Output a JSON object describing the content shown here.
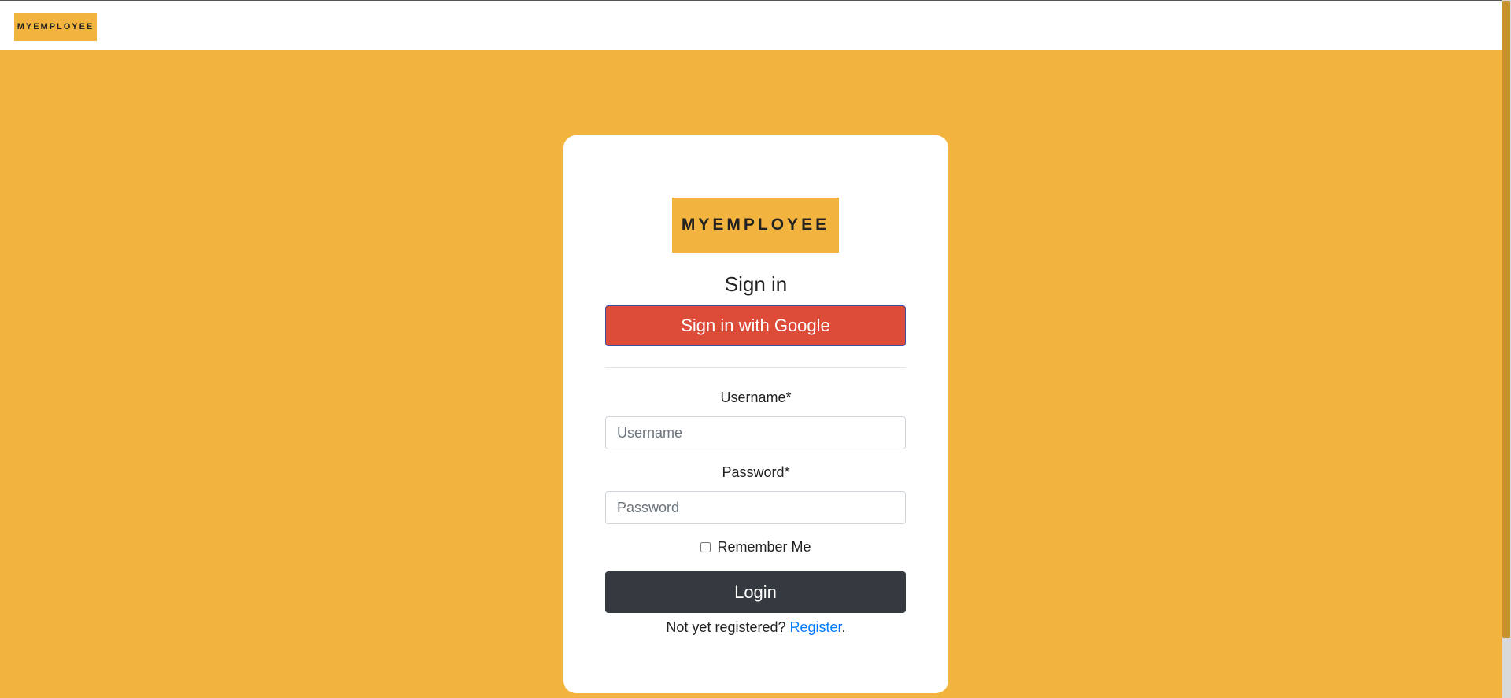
{
  "header": {
    "logo_text": "MYEMPLOYEE"
  },
  "login_card": {
    "logo_text": "MYEMPLOYEE",
    "title": "Sign in",
    "google_button": "Sign in with Google",
    "username": {
      "label": "Username*",
      "placeholder": "Username",
      "value": ""
    },
    "password": {
      "label": "Password*",
      "placeholder": "Password",
      "value": ""
    },
    "remember_me_label": "Remember Me",
    "login_button": "Login",
    "register_prompt": "Not yet registered?",
    "register_link": "Register",
    "register_suffix": "."
  },
  "colors": {
    "brand_yellow": "#f2b43e",
    "google_red": "#dd4b39",
    "login_dark": "#343a40",
    "link_blue": "#007bff"
  }
}
